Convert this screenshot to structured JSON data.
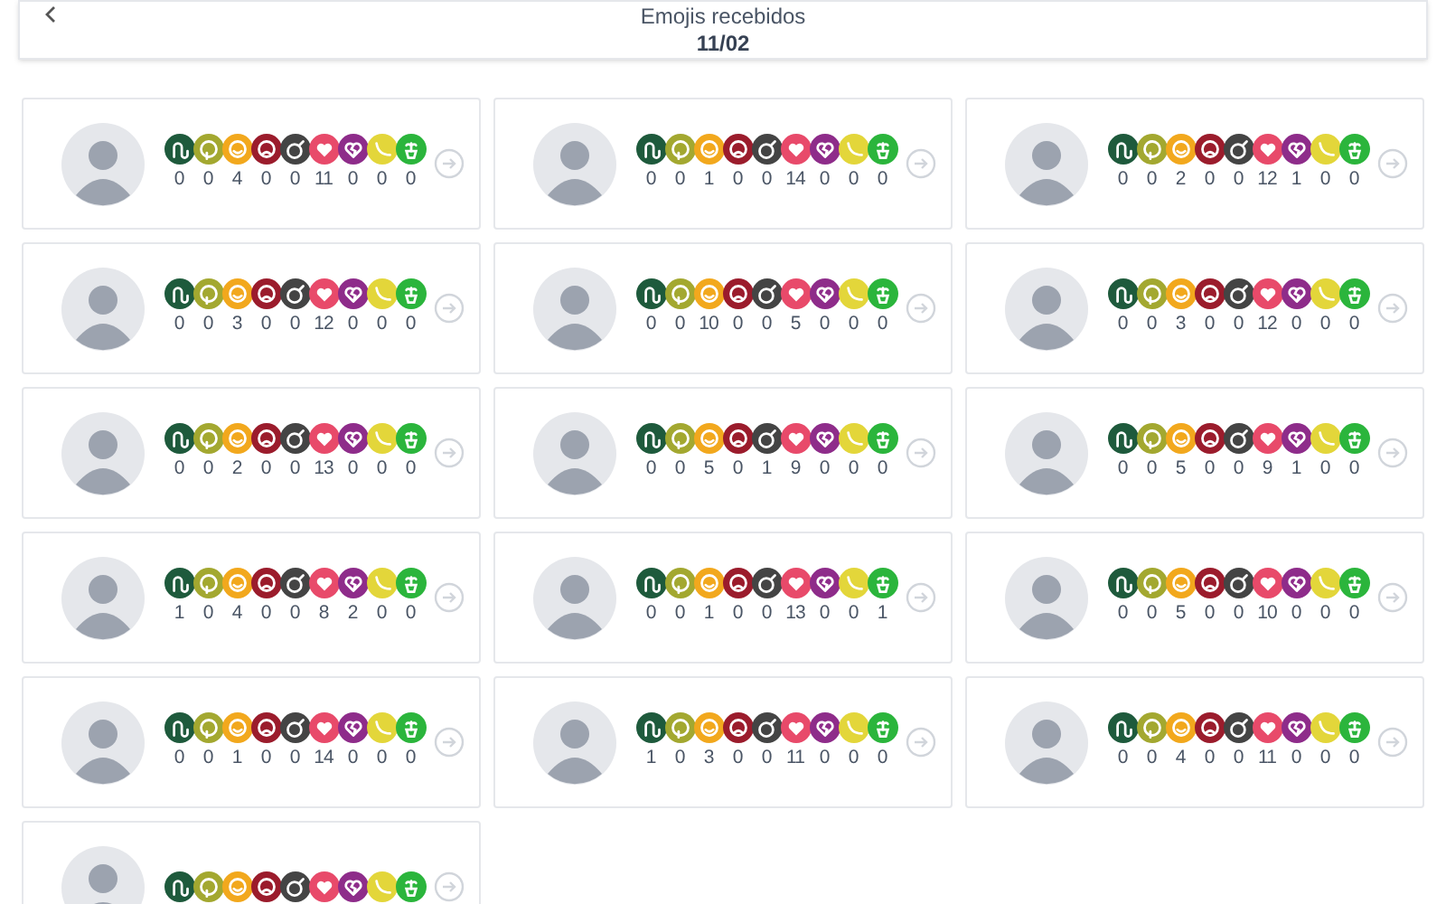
{
  "header": {
    "title": "Emojis recebidos",
    "date": "11/02"
  },
  "emojis": [
    {
      "kind": "snake",
      "color": "#1e5a3c"
    },
    {
      "kind": "vomit",
      "color": "#a3a830"
    },
    {
      "kind": "smile",
      "color": "#f2a81d"
    },
    {
      "kind": "angry",
      "color": "#9b1c2c"
    },
    {
      "kind": "bomb",
      "color": "#444444"
    },
    {
      "kind": "heart",
      "color": "#e84a6a"
    },
    {
      "kind": "broken_heart",
      "color": "#8e2c8a"
    },
    {
      "kind": "banana",
      "color": "#e3d63a"
    },
    {
      "kind": "plant",
      "color": "#2bb53c"
    }
  ],
  "cards": [
    {
      "kind": "participant",
      "counts": [
        "0",
        "0",
        "4",
        "0",
        "0",
        "11",
        "0",
        "0",
        "0"
      ]
    },
    {
      "kind": "participant",
      "counts": [
        "0",
        "0",
        "1",
        "0",
        "0",
        "14",
        "0",
        "0",
        "0"
      ]
    },
    {
      "kind": "participant",
      "counts": [
        "0",
        "0",
        "2",
        "0",
        "0",
        "12",
        "1",
        "0",
        "0"
      ]
    },
    {
      "kind": "participant",
      "counts": [
        "0",
        "0",
        "3",
        "0",
        "0",
        "12",
        "0",
        "0",
        "0"
      ]
    },
    {
      "kind": "participant",
      "counts": [
        "0",
        "0",
        "10",
        "0",
        "0",
        "5",
        "0",
        "0",
        "0"
      ]
    },
    {
      "kind": "participant",
      "counts": [
        "0",
        "0",
        "3",
        "0",
        "0",
        "12",
        "0",
        "0",
        "0"
      ]
    },
    {
      "kind": "participant",
      "counts": [
        "0",
        "0",
        "2",
        "0",
        "0",
        "13",
        "0",
        "0",
        "0"
      ]
    },
    {
      "kind": "participant",
      "counts": [
        "0",
        "0",
        "5",
        "0",
        "1",
        "9",
        "0",
        "0",
        "0"
      ]
    },
    {
      "kind": "participant",
      "counts": [
        "0",
        "0",
        "5",
        "0",
        "0",
        "9",
        "1",
        "0",
        "0"
      ]
    },
    {
      "kind": "participant",
      "counts": [
        "1",
        "0",
        "4",
        "0",
        "0",
        "8",
        "2",
        "0",
        "0"
      ]
    },
    {
      "kind": "participant",
      "counts": [
        "0",
        "0",
        "1",
        "0",
        "0",
        "13",
        "0",
        "0",
        "1"
      ]
    },
    {
      "kind": "participant",
      "counts": [
        "0",
        "0",
        "5",
        "0",
        "0",
        "10",
        "0",
        "0",
        "0"
      ]
    },
    {
      "kind": "participant",
      "counts": [
        "0",
        "0",
        "1",
        "0",
        "0",
        "14",
        "0",
        "0",
        "0"
      ]
    },
    {
      "kind": "participant",
      "counts": [
        "1",
        "0",
        "3",
        "0",
        "0",
        "11",
        "0",
        "0",
        "0"
      ]
    },
    {
      "kind": "participant",
      "counts": [
        "0",
        "0",
        "4",
        "0",
        "0",
        "11",
        "0",
        "0",
        "0"
      ]
    },
    {
      "kind": "participant"
    }
  ]
}
